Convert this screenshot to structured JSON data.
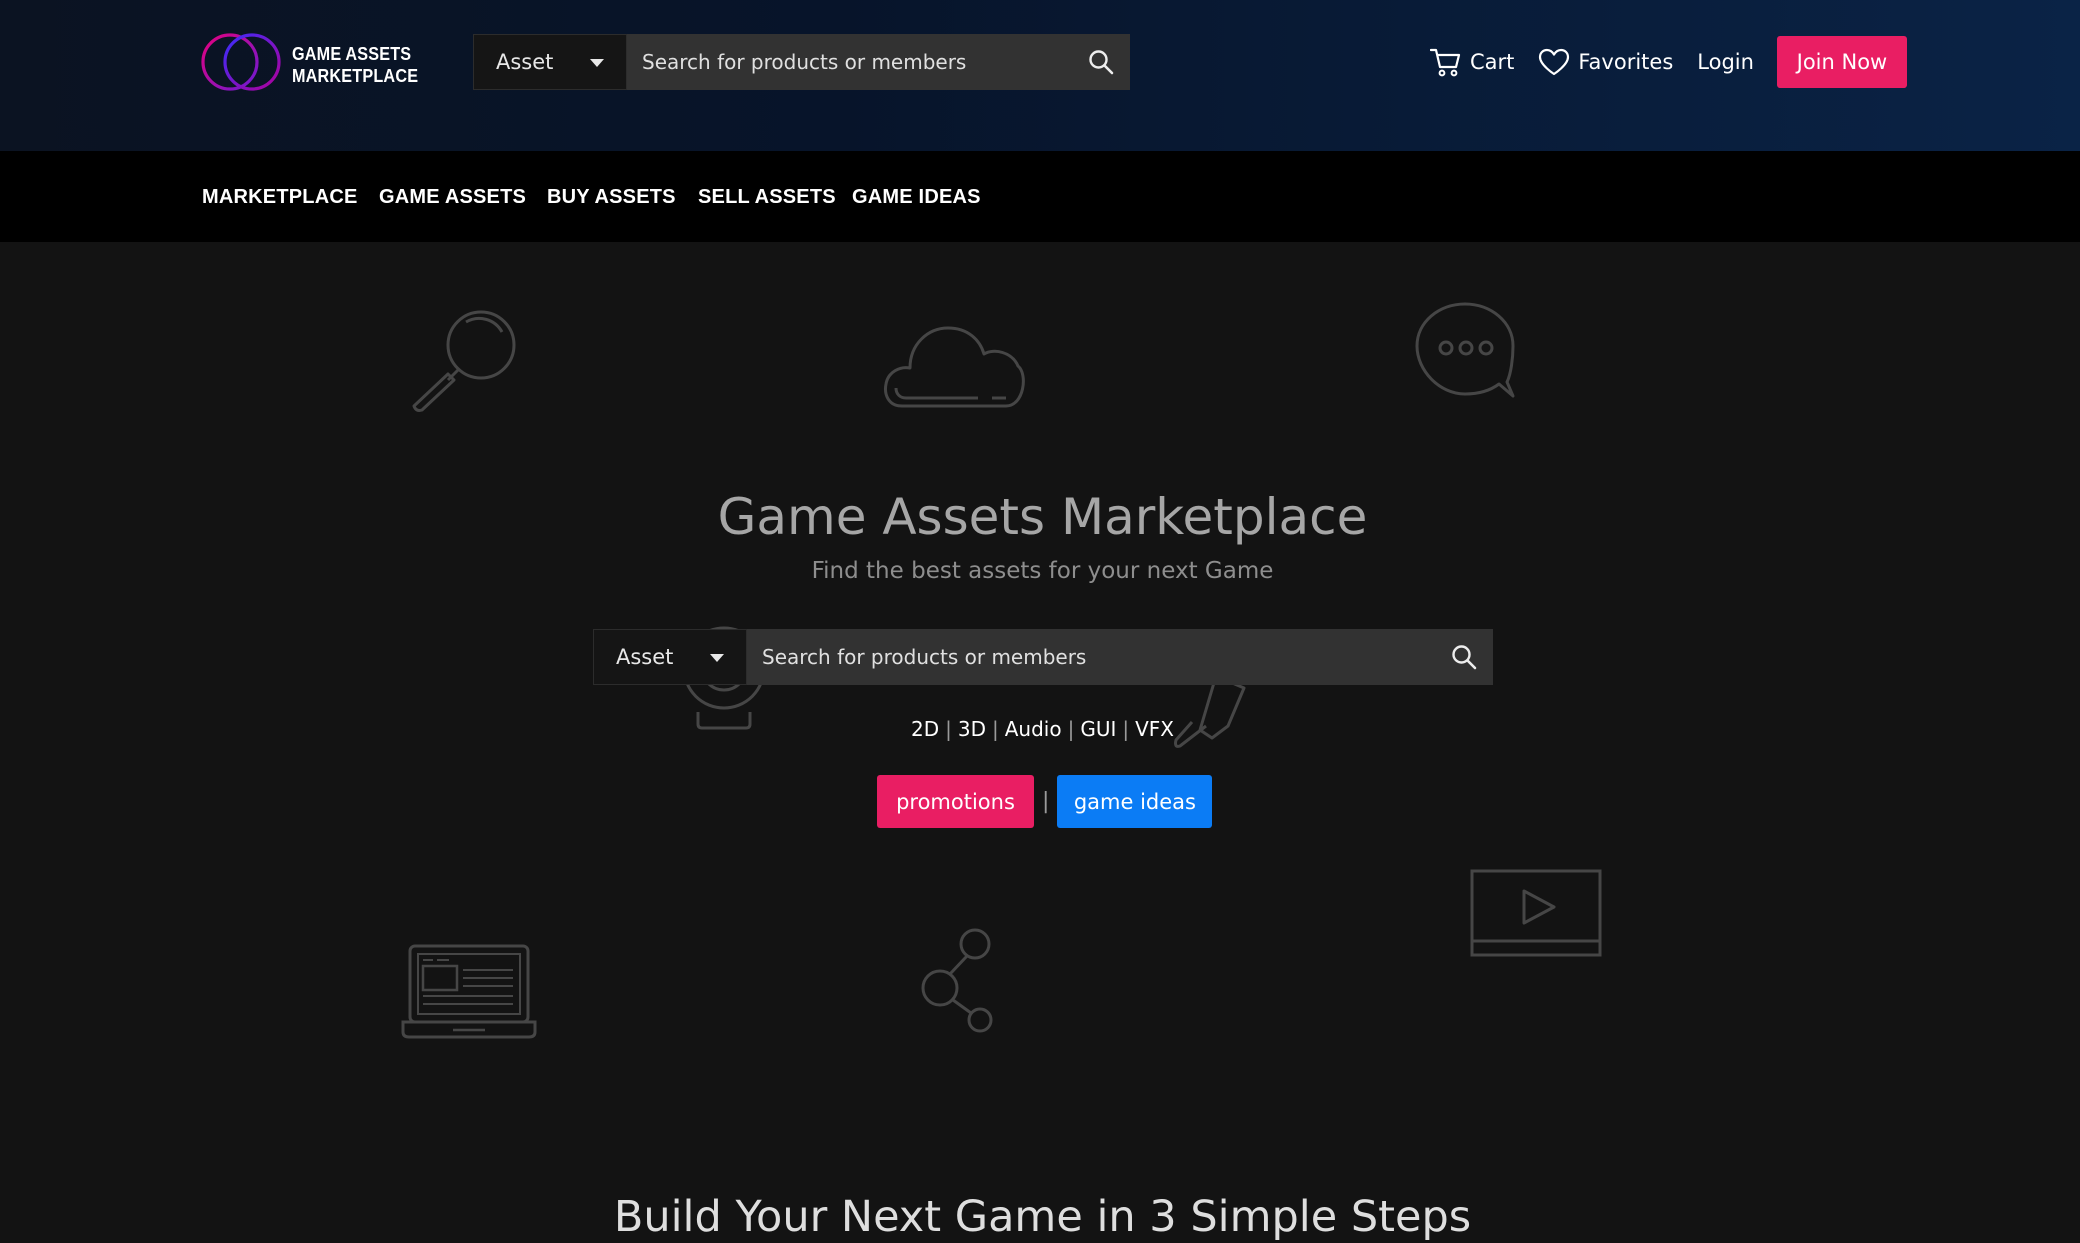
{
  "brand": {
    "line1": "GAME ASSETS",
    "line2": "MARKETPLACE",
    "ring_colors": [
      "#e5007e",
      "#3a2dfc"
    ]
  },
  "header_search": {
    "selected": "Asset",
    "placeholder": "Search for products or members"
  },
  "header_actions": {
    "cart": "Cart",
    "favorites": "Favorites",
    "login": "Login",
    "join": "Join Now"
  },
  "nav": [
    "MARKETPLACE",
    "GAME ASSETS",
    "BUY ASSETS",
    "SELL ASSETS",
    "GAME IDEAS"
  ],
  "hero": {
    "title": "Game Assets Marketplace",
    "subtitle": "Find the best assets for your next Game",
    "search": {
      "selected": "Asset",
      "placeholder": "Search for products or members"
    },
    "categories": [
      "2D",
      "3D",
      "Audio",
      "GUI",
      "VFX"
    ],
    "buttons": {
      "promotions": "promotions",
      "separator": "|",
      "game_ideas": "game ideas"
    }
  },
  "steps_title": "Build Your Next Game in 3 Simple Steps",
  "colors": {
    "accent_pink": "#e91e63",
    "accent_blue": "#0b7cf5",
    "page_bg": "#131313",
    "nav_bg": "#000000"
  },
  "icons": [
    "cart-icon",
    "heart-icon",
    "search-icon",
    "magnifier-deco-icon",
    "cloud-icon",
    "chat-bubble-icon",
    "webcam-icon",
    "pen-icon",
    "laptop-icon",
    "share-icon",
    "video-player-icon"
  ]
}
